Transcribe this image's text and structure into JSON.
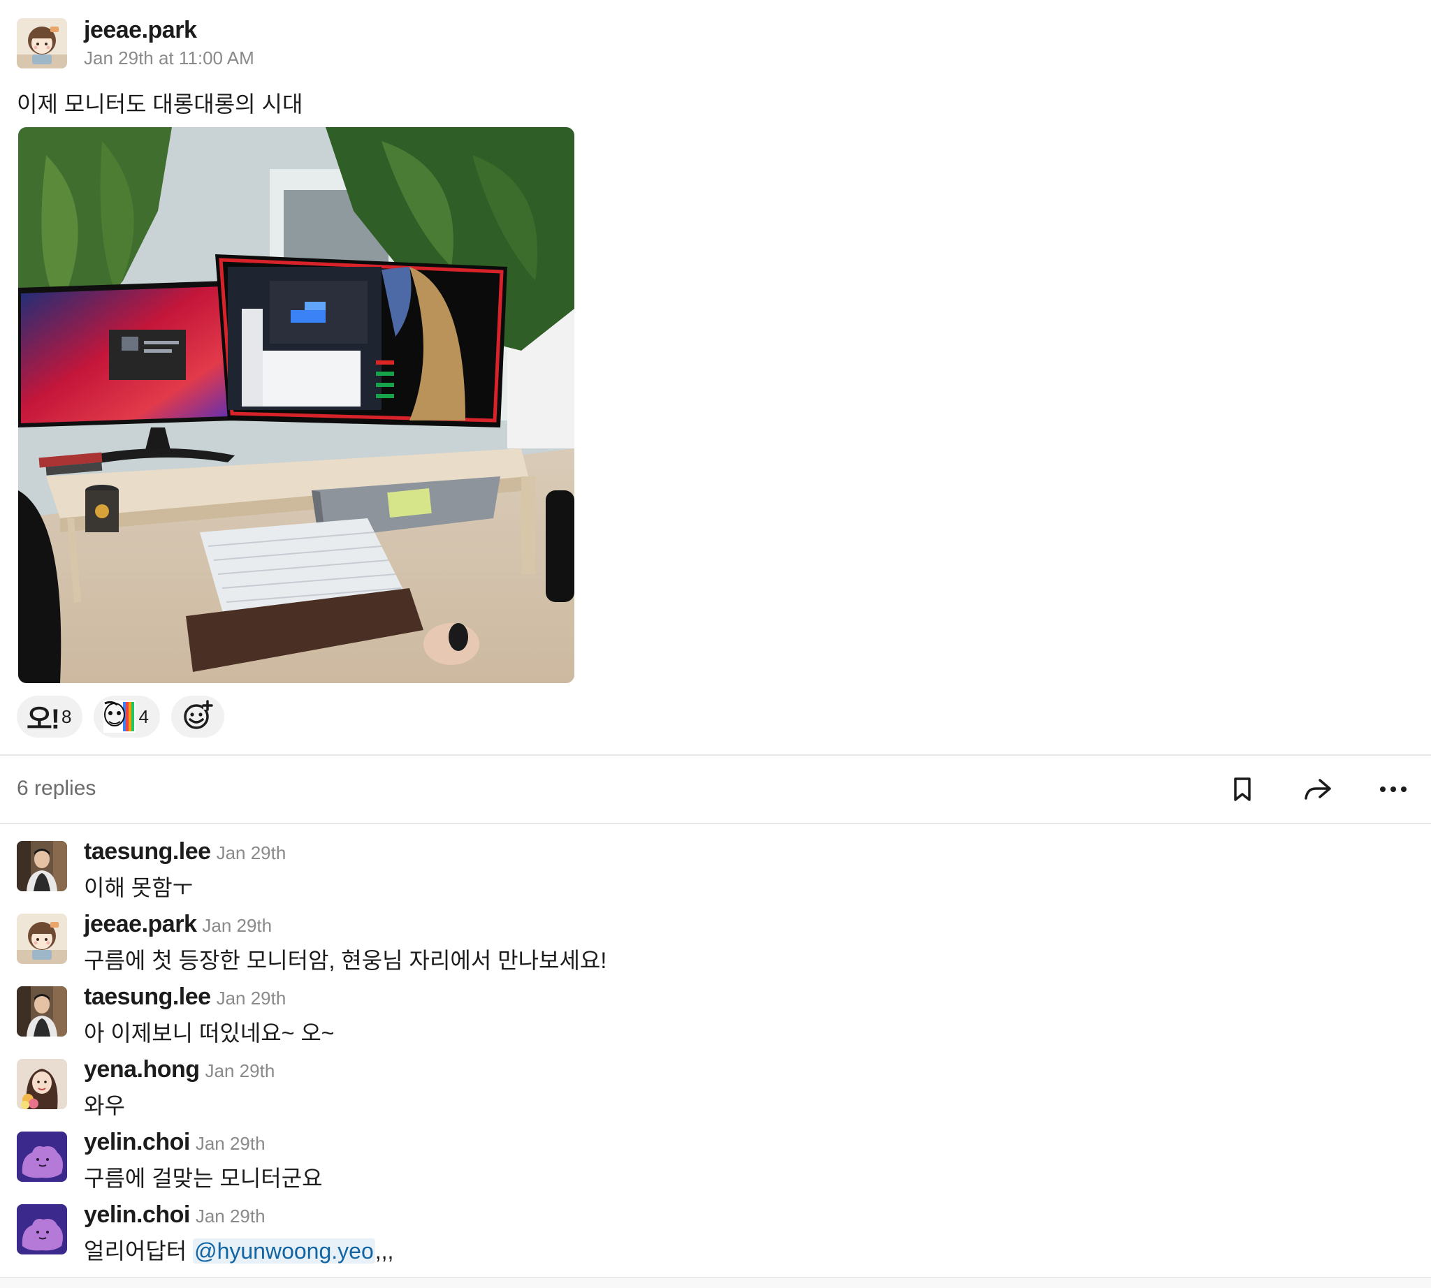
{
  "post": {
    "author": "jeeae.park",
    "timestamp": "Jan 29th at 11:00 AM",
    "text": "이제 모니터도 대롱대롱의 시대",
    "avatar_icon": "cartoon-girl-avatar",
    "attachment_icon": "desk-monitors-photo"
  },
  "reactions": [
    {
      "emoji_text": "오!",
      "count": "8"
    },
    {
      "emoji_icon": "rainbow-face-emoji",
      "count": "4"
    }
  ],
  "add_reaction_icon": "add-emoji-icon",
  "thread": {
    "replies_label": "6 replies",
    "icons": [
      "bookmark-icon",
      "share-icon",
      "more-icon"
    ]
  },
  "replies": [
    {
      "author": "taesung.lee",
      "time": "Jan 29th",
      "text": "이해 못함ㅜ",
      "avatar_icon": "man-photo-avatar"
    },
    {
      "author": "jeeae.park",
      "time": "Jan 29th",
      "text": "구름에 첫 등장한 모니터암, 현웅님 자리에서 만나보세요!",
      "avatar_icon": "cartoon-girl-avatar"
    },
    {
      "author": "taesung.lee",
      "time": "Jan 29th",
      "text": "아 이제보니 떠있네요~ 오~",
      "avatar_icon": "man-photo-avatar"
    },
    {
      "author": "yena.hong",
      "time": "Jan 29th",
      "text": "와우",
      "avatar_icon": "woman-photo-avatar"
    },
    {
      "author": "yelin.choi",
      "time": "Jan 29th",
      "text": "구름에 걸맞는 모니터군요",
      "avatar_icon": "purple-blob-avatar"
    },
    {
      "author": "yelin.choi",
      "time": "Jan 29th",
      "text_before": "얼리어답터 ",
      "mention": "@hyunwoong.yeo",
      "text_after": ",,,",
      "avatar_icon": "purple-blob-avatar"
    }
  ],
  "colors": {
    "mention": "#1264a3",
    "muted": "#8a8a8a",
    "reaction_bg": "#f1f1f1",
    "divider": "#e8e8e8"
  }
}
